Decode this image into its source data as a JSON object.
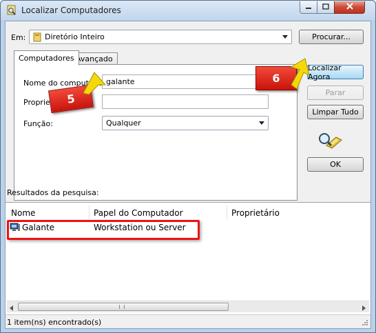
{
  "window": {
    "title": "Localizar Computadores",
    "minimize_icon": "minimize-icon",
    "maximize_icon": "maximize-icon",
    "close_icon": "close-icon"
  },
  "location": {
    "label": "Em:",
    "selected": "Diretório Inteiro",
    "icon": "directory-icon",
    "browse_label": "Procurar..."
  },
  "tabs": [
    {
      "label": "Computadores",
      "active": true
    },
    {
      "label": "Avançado",
      "active": false
    }
  ],
  "form": {
    "name_label": "Nome do computador:",
    "name_value": "galante",
    "owner_label": "Proprietário:",
    "owner_value": "",
    "role_label": "Função:",
    "role_selected": "Qualquer"
  },
  "actions": {
    "find_now": "Localizar Agora",
    "stop": "Parar",
    "clear_all": "Limpar Tudo",
    "ok": "OK",
    "search_icon": "magnifier-icon"
  },
  "results": {
    "title": "Resultados da pesquisa:",
    "columns": [
      "Nome",
      "Papel do Computador",
      "Proprietário"
    ],
    "rows": [
      {
        "name": "Galante",
        "role": "Workstation ou Server",
        "owner": "",
        "icon": "computer-icon"
      }
    ]
  },
  "status": {
    "text": "1 item(ns) encontrado(s)"
  },
  "annotations": {
    "step_a": "5",
    "step_b": "6"
  },
  "colors": {
    "title_bar": "#c2d6ec",
    "close_button": "#c94a37",
    "badge": "#d8140a",
    "highlight": "#ee1111",
    "arrow": "#f5d80a"
  }
}
